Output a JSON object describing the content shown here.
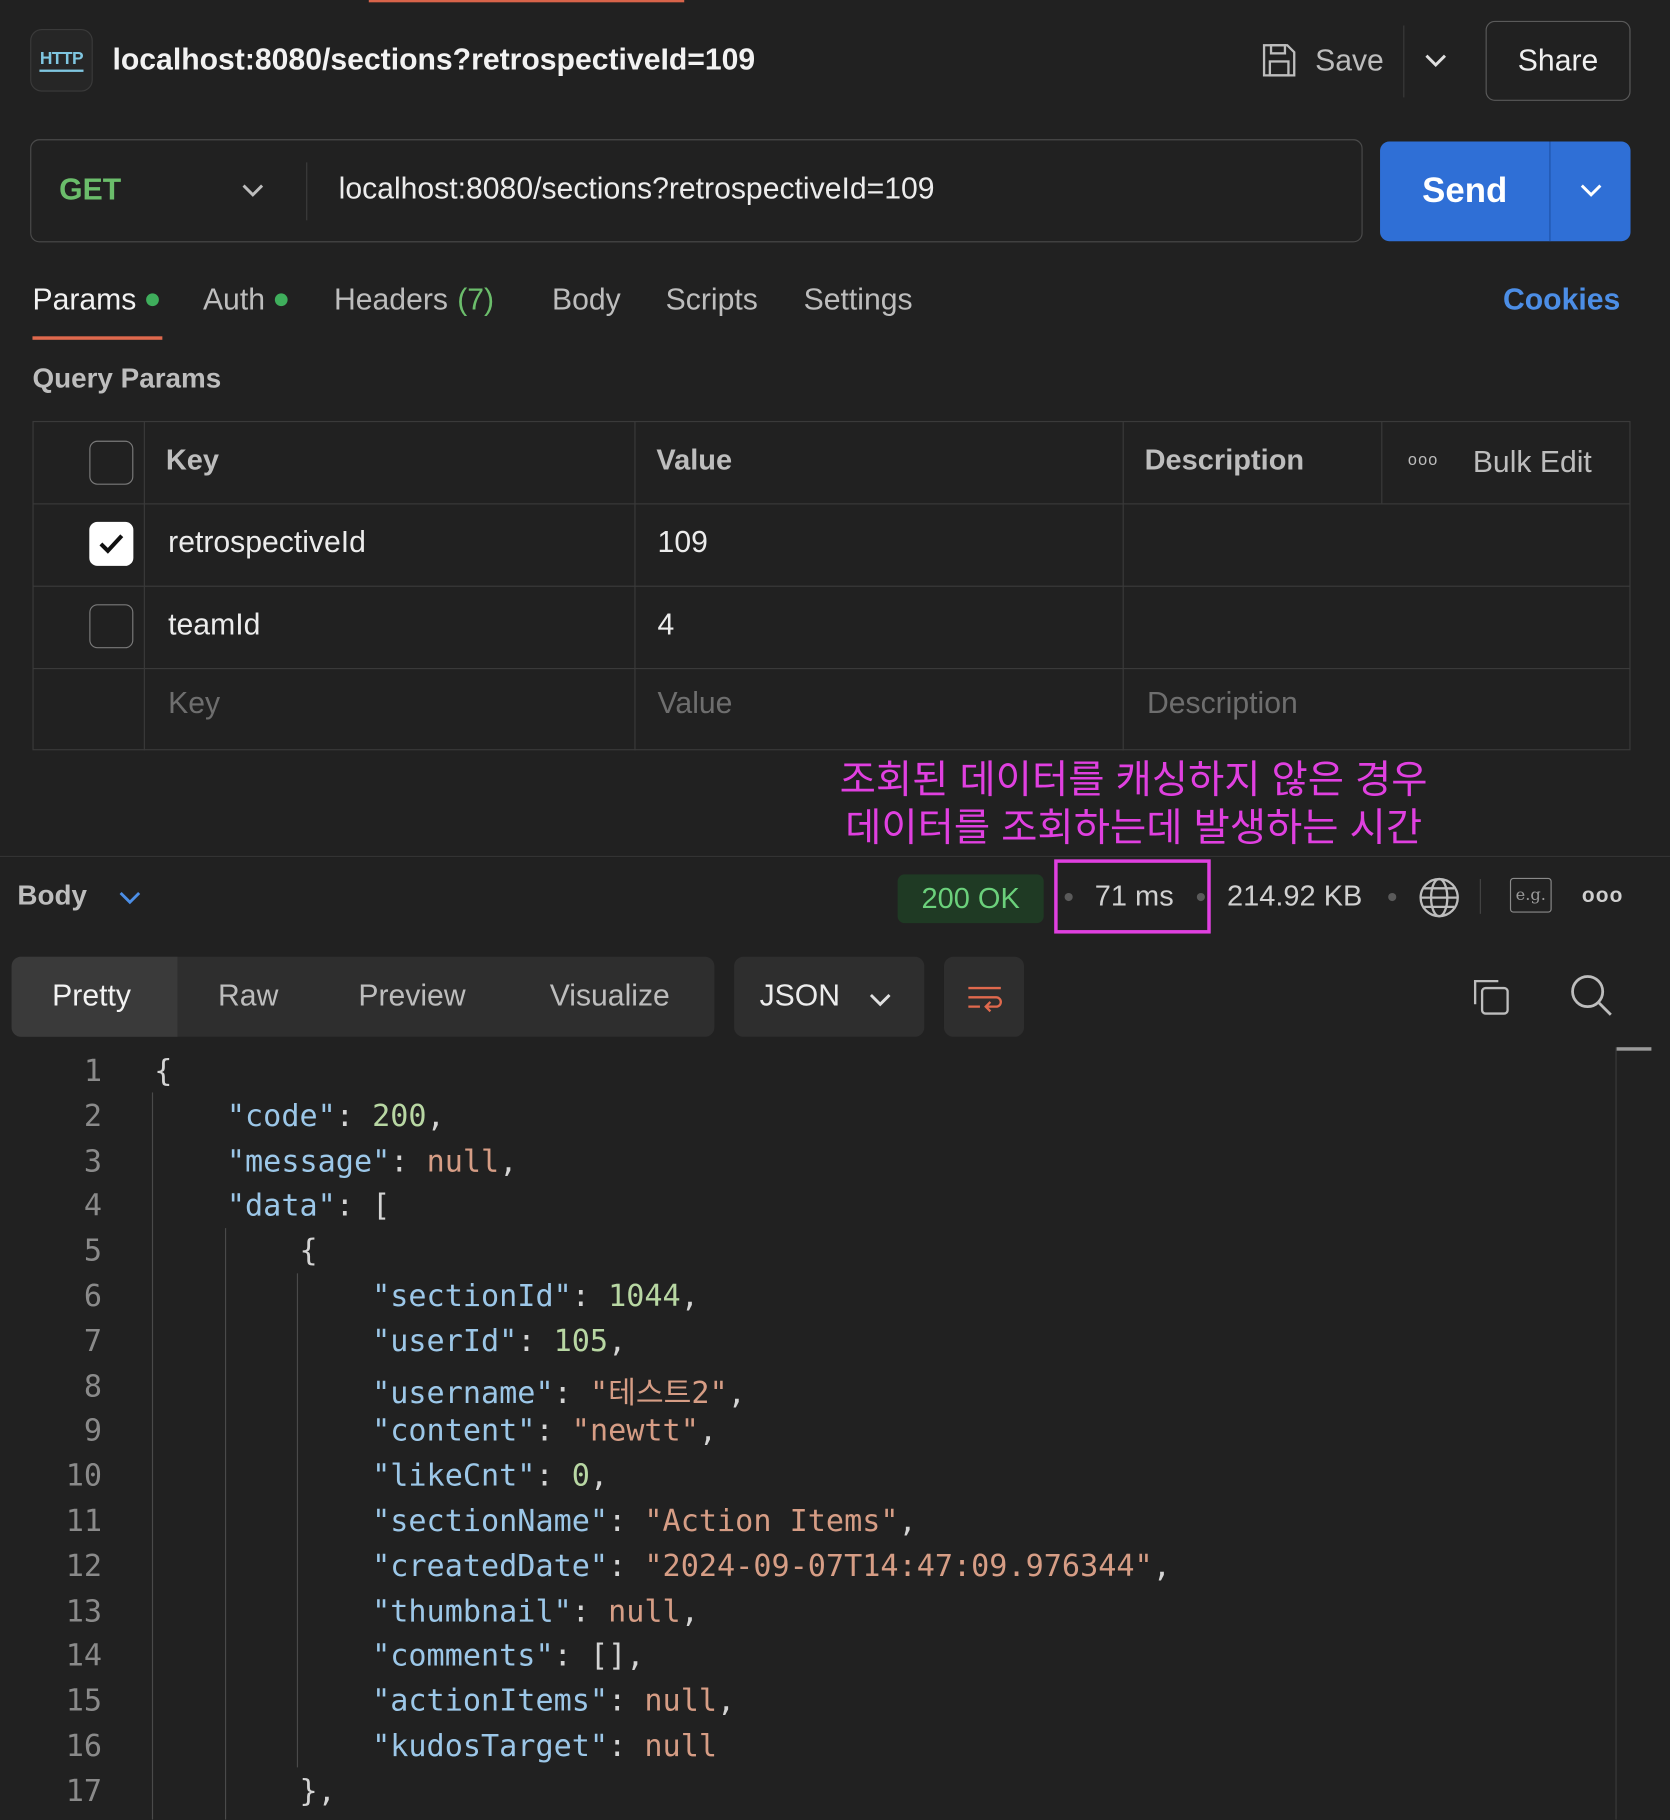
{
  "header": {
    "badge": "HTTP",
    "title": "localhost:8080/sections?retrospectiveId=109",
    "save_label": "Save",
    "share_label": "Share"
  },
  "request": {
    "method": "GET",
    "url": "localhost:8080/sections?retrospectiveId=109",
    "send_label": "Send"
  },
  "tabs": {
    "params": "Params",
    "auth": "Auth",
    "headers": "Headers",
    "headers_count": "(7)",
    "body": "Body",
    "scripts": "Scripts",
    "settings": "Settings",
    "cookies": "Cookies",
    "active": "Params",
    "indicator_color": "#3fae5c"
  },
  "query_params": {
    "title": "Query Params",
    "columns": {
      "key": "Key",
      "value": "Value",
      "description": "Description",
      "bulk_edit": "Bulk Edit"
    },
    "rows": [
      {
        "checked": true,
        "key": "retrospectiveId",
        "value": "109",
        "description": ""
      },
      {
        "checked": false,
        "key": "teamId",
        "value": "4",
        "description": ""
      }
    ],
    "placeholder": {
      "key": "Key",
      "value": "Value",
      "description": "Description"
    }
  },
  "annotation": {
    "line1": "조회된 데이터를 캐싱하지 않은 경우",
    "line2": "데이터를 조회하는데 발생하는 시간",
    "color": "#e040e0"
  },
  "response": {
    "section_label": "Body",
    "status": "200 OK",
    "time": "71 ms",
    "size": "214.92 KB",
    "eg_label": "e.g.",
    "view_tabs": [
      "Pretty",
      "Raw",
      "Preview",
      "Visualize"
    ],
    "active_view": "Pretty",
    "format": "JSON"
  },
  "code_lines": [
    {
      "n": "1"
    },
    {
      "n": "2"
    },
    {
      "n": "3"
    },
    {
      "n": "4"
    },
    {
      "n": "5"
    },
    {
      "n": "6"
    },
    {
      "n": "7"
    },
    {
      "n": "8"
    },
    {
      "n": "9"
    },
    {
      "n": "10"
    },
    {
      "n": "11"
    },
    {
      "n": "12"
    },
    {
      "n": "13"
    },
    {
      "n": "14"
    },
    {
      "n": "15"
    },
    {
      "n": "16"
    },
    {
      "n": "17"
    }
  ],
  "json": {
    "open": "{",
    "k_code": "\"code\"",
    "v_code": "200",
    "k_message": "\"message\"",
    "v_message": "null",
    "k_data": "\"data\"",
    "v_data_open": "[",
    "obj_open": "{",
    "k_sectionId": "\"sectionId\"",
    "v_sectionId": "1044",
    "k_userId": "\"userId\"",
    "v_userId": "105",
    "k_username": "\"username\"",
    "v_username": "\"테스트2\"",
    "k_content": "\"content\"",
    "v_content": "\"newtt\"",
    "k_likeCnt": "\"likeCnt\"",
    "v_likeCnt": "0",
    "k_sectionName": "\"sectionName\"",
    "v_sectionName": "\"Action Items\"",
    "k_createdDate": "\"createdDate\"",
    "v_createdDate": "\"2024-09-07T14:47:09.976344\"",
    "k_thumbnail": "\"thumbnail\"",
    "v_thumbnail": "null",
    "k_comments": "\"comments\"",
    "v_comments": "[]",
    "k_actionItems": "\"actionItems\"",
    "v_actionItems": "null",
    "k_kudosTarget": "\"kudosTarget\"",
    "v_kudosTarget": "null",
    "obj_close": "},"
  }
}
